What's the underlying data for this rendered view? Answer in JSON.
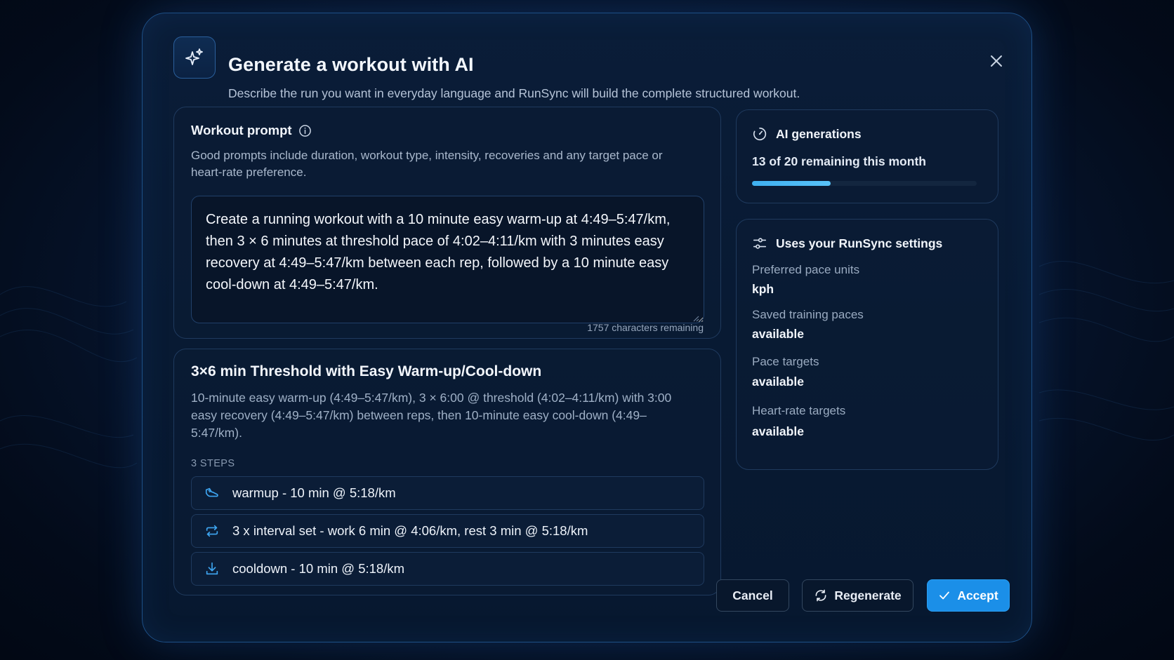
{
  "header": {
    "icon": "sparkles-icon",
    "title": "Generate a workout with AI",
    "subtitle": "Describe the run you want in everyday language and RunSync will build the complete structured workout."
  },
  "prompt": {
    "label": "Workout prompt",
    "hint": "Good prompts include duration, workout type, intensity, recoveries and any target pace or heart-rate preference.",
    "value": "Create a running workout with a 10 minute easy warm-up at 4:49–5:47/km, then 3 × 6 minutes at threshold pace of 4:02–4:11/km with 3 minutes easy recovery at 4:49–5:47/km between each rep, followed by a 10 minute easy cool-down at 4:49–5:47/km.",
    "chars_remaining": "1757 characters remaining"
  },
  "preview": {
    "title": "3×6 min Threshold with Easy Warm-up/Cool-down",
    "description": "10-minute easy warm-up (4:49–5:47/km), 3 × 6:00 @ threshold (4:02–4:11/km) with 3:00 easy recovery (4:49–5:47/km) between reps, then 10-minute easy cool-down (4:49–5:47/km).",
    "steps_label": "3 STEPS",
    "steps": [
      {
        "icon": "shoe-icon",
        "label": "warmup - 10 min @ 5:18/km"
      },
      {
        "icon": "repeat-icon",
        "label": "3 x interval set - work 6 min @ 4:06/km, rest 3 min @ 5:18/km"
      },
      {
        "icon": "download-icon",
        "label": "cooldown - 10 min @ 5:18/km"
      }
    ]
  },
  "generations": {
    "icon": "gauge-icon",
    "title": "AI generations",
    "status": "13 of 20 remaining this month",
    "used": 7,
    "total": 20
  },
  "settings": {
    "icon": "sliders-icon",
    "title": "Uses your RunSync settings",
    "items": [
      {
        "label": "Preferred pace units",
        "value": "kph"
      },
      {
        "label": "Saved training paces",
        "value": "available"
      },
      {
        "label": "Pace targets",
        "value": "available"
      },
      {
        "label": "Heart-rate targets",
        "value": "available"
      }
    ]
  },
  "footer": {
    "cancel_label": "Cancel",
    "regenerate_label": "Regenerate",
    "accept_label": "Accept"
  },
  "colors": {
    "accent": "#1b8fe8",
    "progress": "#4ab8f4",
    "background": "#071630"
  }
}
